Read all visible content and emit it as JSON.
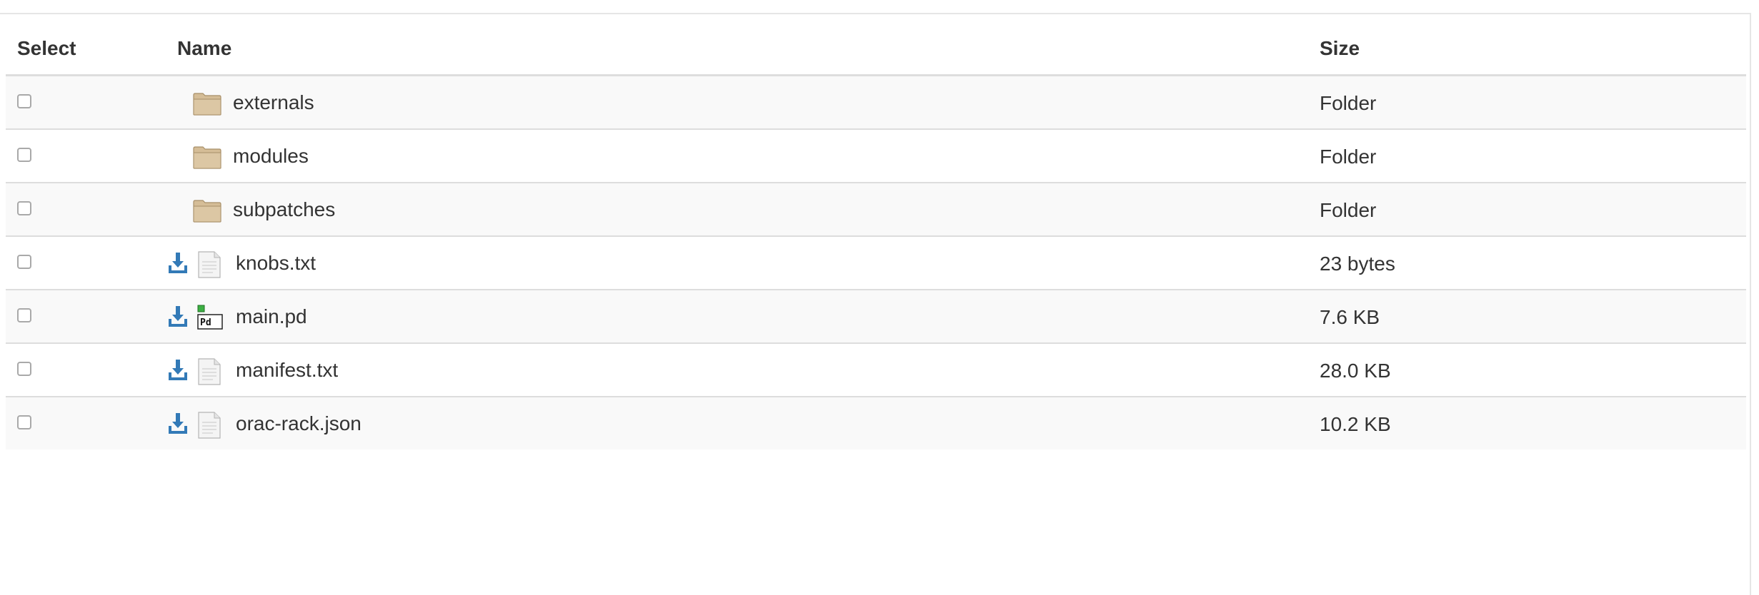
{
  "table": {
    "headers": {
      "select": "Select",
      "name": "Name",
      "size": "Size"
    },
    "rows": [
      {
        "name": "externals",
        "size": "Folder",
        "type": "folder",
        "icon": "folder-icon"
      },
      {
        "name": "modules",
        "size": "Folder",
        "type": "folder",
        "icon": "folder-icon"
      },
      {
        "name": "subpatches",
        "size": "Folder",
        "type": "folder",
        "icon": "folder-icon"
      },
      {
        "name": "knobs.txt",
        "size": "23 bytes",
        "type": "file",
        "icon": "text-file-icon"
      },
      {
        "name": "main.pd",
        "size": "7.6 KB",
        "type": "file",
        "icon": "pd-file-icon"
      },
      {
        "name": "manifest.txt",
        "size": "28.0 KB",
        "type": "file",
        "icon": "text-file-icon"
      },
      {
        "name": "orac-rack.json",
        "size": "10.2 KB",
        "type": "file",
        "icon": "text-file-icon"
      }
    ]
  },
  "colors": {
    "download_icon": "#337ab7",
    "folder_fill": "#d9c4a0",
    "row_stripe": "#f9f9f9",
    "border": "#dddddd"
  }
}
